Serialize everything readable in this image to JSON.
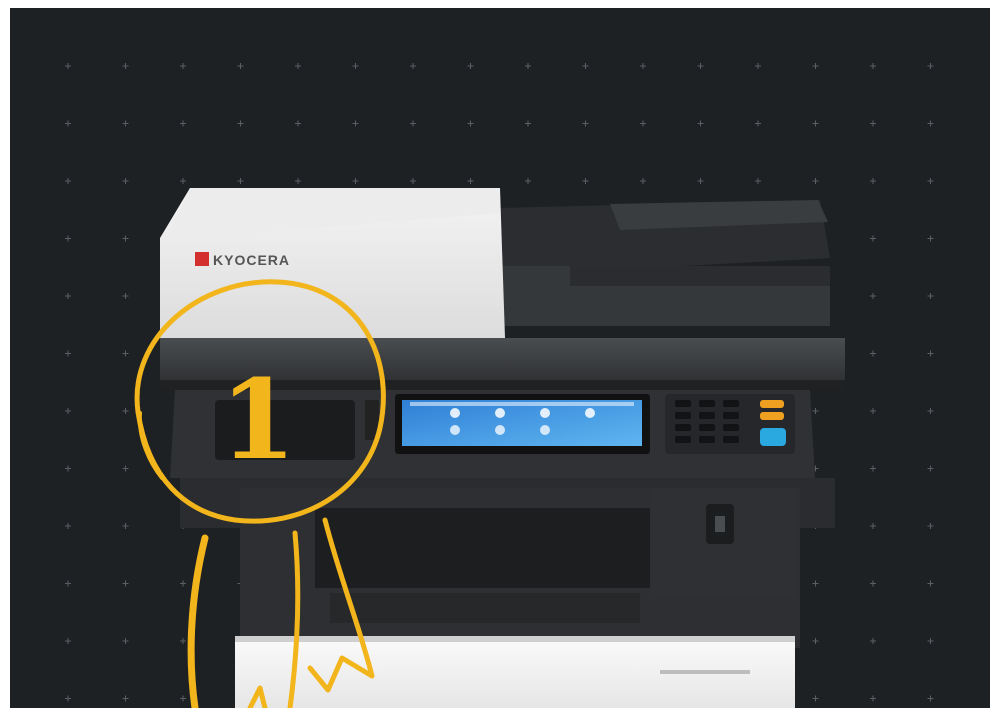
{
  "scene": {
    "background_color": "#1e2124",
    "grid_marker_color": "#5a5f63",
    "accent_color": "#f2b51c"
  },
  "printer": {
    "brand_label": "KYOCERA",
    "touchscreen_state": "home-menu"
  },
  "annotation": {
    "number": "1"
  }
}
